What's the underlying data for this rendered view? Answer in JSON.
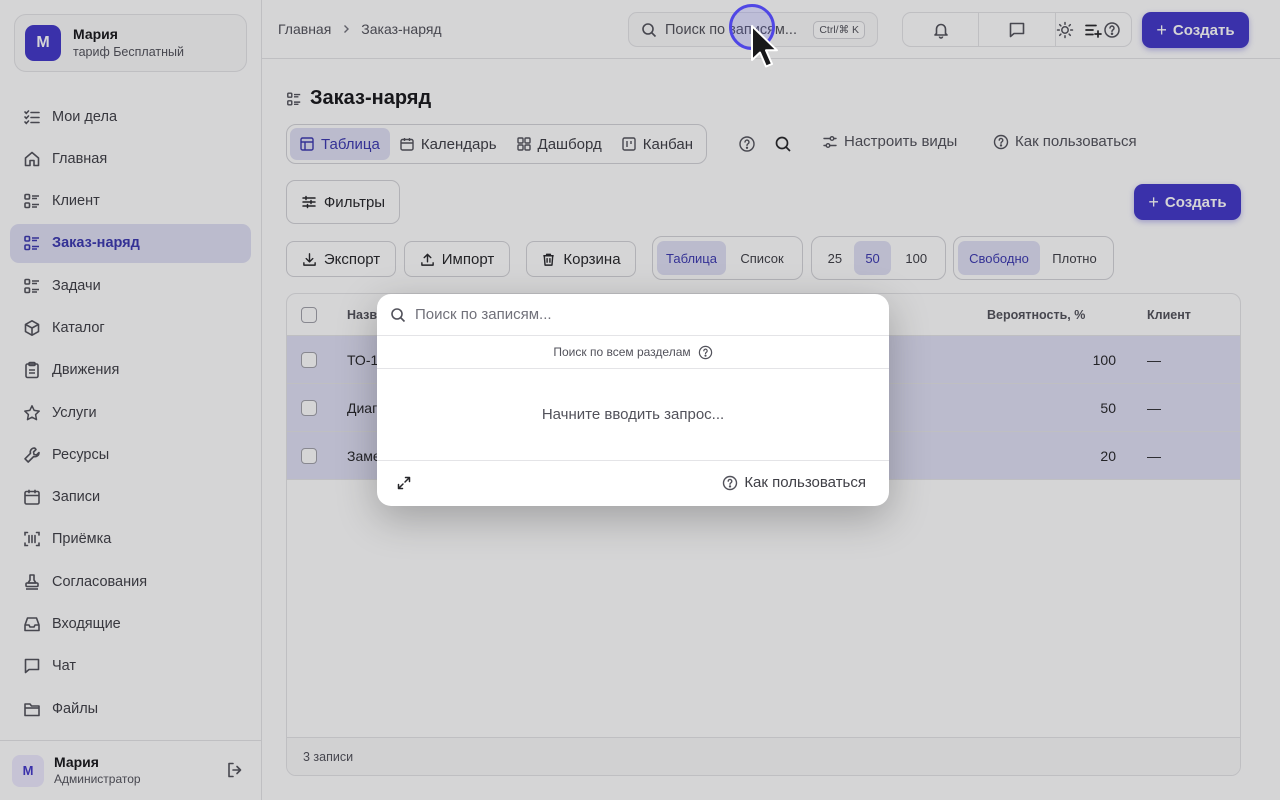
{
  "user": {
    "initial": "М",
    "name": "Мария",
    "plan": "тариф Бесплатный",
    "role": "Администратор"
  },
  "sidebar": {
    "items": [
      {
        "label": "Мои дела",
        "icon": "list-check-icon"
      },
      {
        "label": "Главная",
        "icon": "home-icon"
      },
      {
        "label": "Клиент",
        "icon": "list-icon"
      },
      {
        "label": "Заказ-наряд",
        "icon": "list-icon",
        "active": true
      },
      {
        "label": "Задачи",
        "icon": "list-icon"
      },
      {
        "label": "Каталог",
        "icon": "box-icon"
      },
      {
        "label": "Движения",
        "icon": "clipboard-icon"
      },
      {
        "label": "Услуги",
        "icon": "star-icon"
      },
      {
        "label": "Ресурсы",
        "icon": "wrench-icon"
      },
      {
        "label": "Записи",
        "icon": "calendar-icon"
      },
      {
        "label": "Приёмка",
        "icon": "scan-icon"
      },
      {
        "label": "Согласования",
        "icon": "stamp-icon"
      },
      {
        "label": "Входящие",
        "icon": "inbox-icon"
      },
      {
        "label": "Чат",
        "icon": "chat-icon"
      },
      {
        "label": "Файлы",
        "icon": "folder-icon"
      }
    ]
  },
  "topbar": {
    "breadcrumbs": [
      "Главная",
      "Заказ-наряд"
    ],
    "search_placeholder": "Поиск по записям...",
    "search_shortcut": "Ctrl/⌘ K",
    "create_label": "Создать"
  },
  "page": {
    "title": "Заказ-наряд",
    "view_tabs": [
      {
        "label": "Таблица",
        "active": true
      },
      {
        "label": "Календарь"
      },
      {
        "label": "Дашборд"
      },
      {
        "label": "Канбан"
      }
    ],
    "configure_views": "Настроить виды",
    "how_to_use": "Как пользоваться",
    "filters": "Фильтры",
    "create_label": "Создать",
    "actions": {
      "export": "Экспорт",
      "import": "Импорт",
      "trash": "Корзина"
    },
    "view_mode": {
      "table": "Таблица",
      "list": "Список",
      "selected": "Таблица"
    },
    "page_size": {
      "options": [
        "25",
        "50",
        "100"
      ],
      "selected": "50"
    },
    "density": {
      "free": "Свободно",
      "dense": "Плотно",
      "selected": "Свободно"
    }
  },
  "table": {
    "columns": {
      "name": "Назв",
      "probability": "Вероятность, %",
      "client": "Клиент"
    },
    "rows": [
      {
        "name": "ТО-1",
        "probability": "100",
        "client": "—"
      },
      {
        "name": "Диаг",
        "probability": "50",
        "client": "—"
      },
      {
        "name": "Заме",
        "probability": "20",
        "client": "—"
      }
    ],
    "footer": "3 записи"
  },
  "search_modal": {
    "placeholder": "Поиск по записям...",
    "scope": "Поиск по всем разделам",
    "empty_text": "Начните вводить запрос...",
    "help_label": "Как пользоваться"
  },
  "colors": {
    "accent": "#4338ca",
    "active_bg": "#e0e0f5",
    "overlay": "rgba(24,24,27,0.18)"
  }
}
